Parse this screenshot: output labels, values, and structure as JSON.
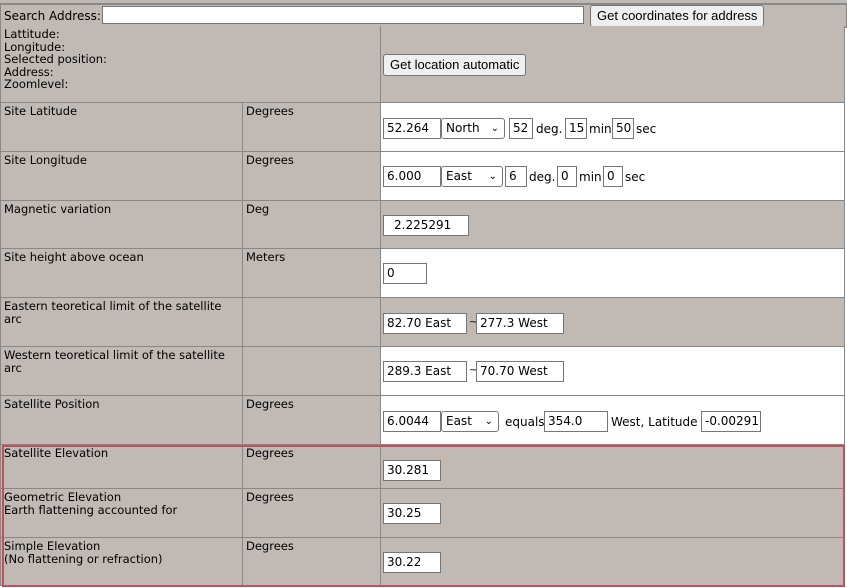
{
  "search": {
    "label": "Search Address:",
    "value": "",
    "button": "Get coordinates for address"
  },
  "info": {
    "lines": [
      "Lattitude:",
      "Longitude:",
      "Selected position:",
      "Address:",
      "Zoomlevel:"
    ],
    "button": "Get location automatic"
  },
  "site_latitude": {
    "label": "Site Latitude",
    "unit": "Degrees",
    "value": "52.264",
    "hemisphere": "North",
    "deg": "52",
    "deg_label": "deg.",
    "min": "15",
    "min_label": "min",
    "sec": "50",
    "sec_label": "sec"
  },
  "site_longitude": {
    "label": "Site Longitude",
    "unit": "Degrees",
    "value": "6.000",
    "hemisphere": "East",
    "deg": "6",
    "deg_label": "deg.",
    "min": "0",
    "min_label": "min",
    "sec": "0",
    "sec_label": "sec"
  },
  "magnetic_variation": {
    "label": "Magnetic variation",
    "unit": "Deg",
    "value": "2.225291"
  },
  "site_height": {
    "label": "Site height above ocean",
    "unit": "Meters",
    "value": "0"
  },
  "eastern_limit": {
    "label_line1": "Eastern teoretical limit of the satellite",
    "label_line2": "arc",
    "unit": "",
    "value1": "82.70 East",
    "sep": "~",
    "value2": "277.3 West"
  },
  "western_limit": {
    "label_line1": "Western teoretical limit of the satellite",
    "label_line2": "arc",
    "unit": "",
    "value1": "289.3 East",
    "sep": "~",
    "value2": "70.70 West"
  },
  "satellite_position": {
    "label": "Satellite Position",
    "unit": "Degrees",
    "value": "6.0044",
    "direction": "East",
    "equals_label": "equals",
    "equals_value": "354.0",
    "west_latitude_label": "West, Latitude",
    "latitude_value": "-0.00291"
  },
  "satellite_elevation": {
    "label": "Satellite Elevation",
    "unit": "Degrees",
    "value": "30.281"
  },
  "geometric_elevation": {
    "label_line1": "Geometric Elevation",
    "label_line2": "Earth flattening accounted for",
    "unit": "Degrees",
    "value": "30.25"
  },
  "simple_elevation": {
    "label_line1": "Simple Elevation",
    "label_line2": "(No flattening or refraction)",
    "unit": "Degrees",
    "value": "30.22"
  },
  "colors": {
    "cell_grey": "#c0b9b4",
    "highlight_border": "#c0505a"
  }
}
